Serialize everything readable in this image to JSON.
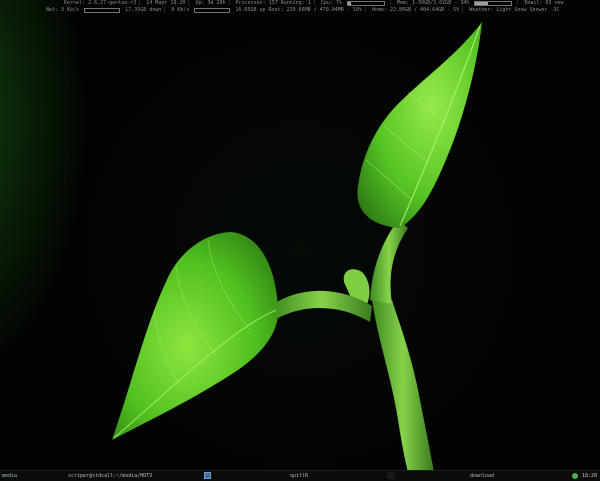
{
  "conky": {
    "row1": {
      "kernel": "Kernel: 2.6.27-gentoo-r3",
      "datetime": "14 Mapr 18:20",
      "uptime": "Up: 3d 20h",
      "processes": "Processes: 157 Running: 1",
      "cpu": "Cpu: 7%",
      "cpu_level": 0.07,
      "mem": "Mem: 1.00GB/3.02GB - 34%",
      "mem_level": 0.34,
      "email": "Email: 63 new"
    },
    "row2": {
      "net_down": "Net: 3 Kb/s",
      "net_down_total": "17.35GB down",
      "net_up": "0 Kb/s",
      "net_up_total": "16.05GB up",
      "root": "Root: 239.66MB / 470.94MB - 50%",
      "home": "Home: 22.86GB / 404.64GB - 5%",
      "weather": "Weather: Light Snow Shower -3C"
    }
  },
  "taskbar": {
    "workspace": "media",
    "terminal_title": "scriper@stdcall:~/media/HDTV",
    "tab_quit": "quitlR",
    "tab_download": "download",
    "clock": "18:20"
  },
  "colors": {
    "leaf": "#5fcf2a",
    "stem": "#6fbf3a",
    "background": "#020402"
  }
}
